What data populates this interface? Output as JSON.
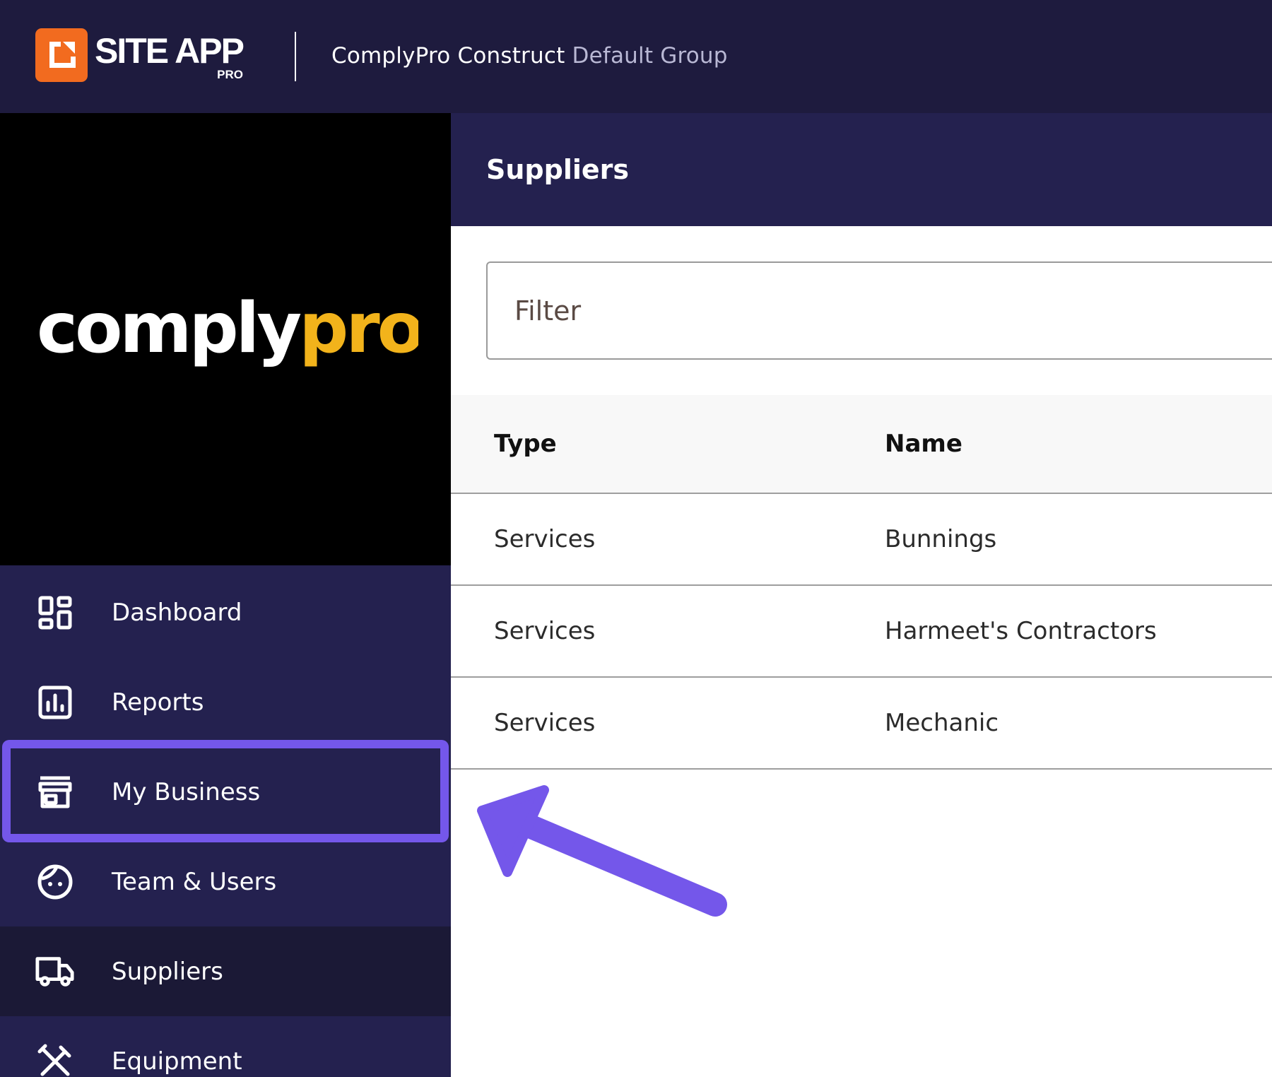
{
  "brand": {
    "name": "SITE APP",
    "sub": "PRO",
    "icon": "site-app-logo-icon",
    "color": "#f26b1f"
  },
  "org": {
    "name": "ComplyPro Construct",
    "group": "Default Group"
  },
  "client_logo": {
    "left": "comply",
    "right": "pro",
    "left_color": "#ffffff",
    "right_color": "#f2b31b"
  },
  "sidebar": {
    "items": [
      {
        "label": "Dashboard",
        "icon": "dashboard-icon"
      },
      {
        "label": "Reports",
        "icon": "reports-icon"
      },
      {
        "label": "My Business",
        "icon": "store-icon"
      },
      {
        "label": "Team & Users",
        "icon": "face-icon"
      },
      {
        "label": "Suppliers",
        "icon": "truck-icon",
        "active": true
      },
      {
        "label": "Equipment",
        "icon": "tools-icon"
      }
    ]
  },
  "page": {
    "title": "Suppliers"
  },
  "filter": {
    "placeholder": "Filter"
  },
  "table": {
    "columns": [
      "Type",
      "Name"
    ],
    "rows": [
      {
        "type": "Services",
        "name": "Bunnings"
      },
      {
        "type": "Services",
        "name": "Harmeet's Contractors"
      },
      {
        "type": "Services",
        "name": "Mechanic"
      }
    ]
  },
  "colors": {
    "topbar": "#1e1b3e",
    "sidebar": "#24214f",
    "sidebar_active": "#1b1936",
    "highlight": "#7457ea"
  }
}
